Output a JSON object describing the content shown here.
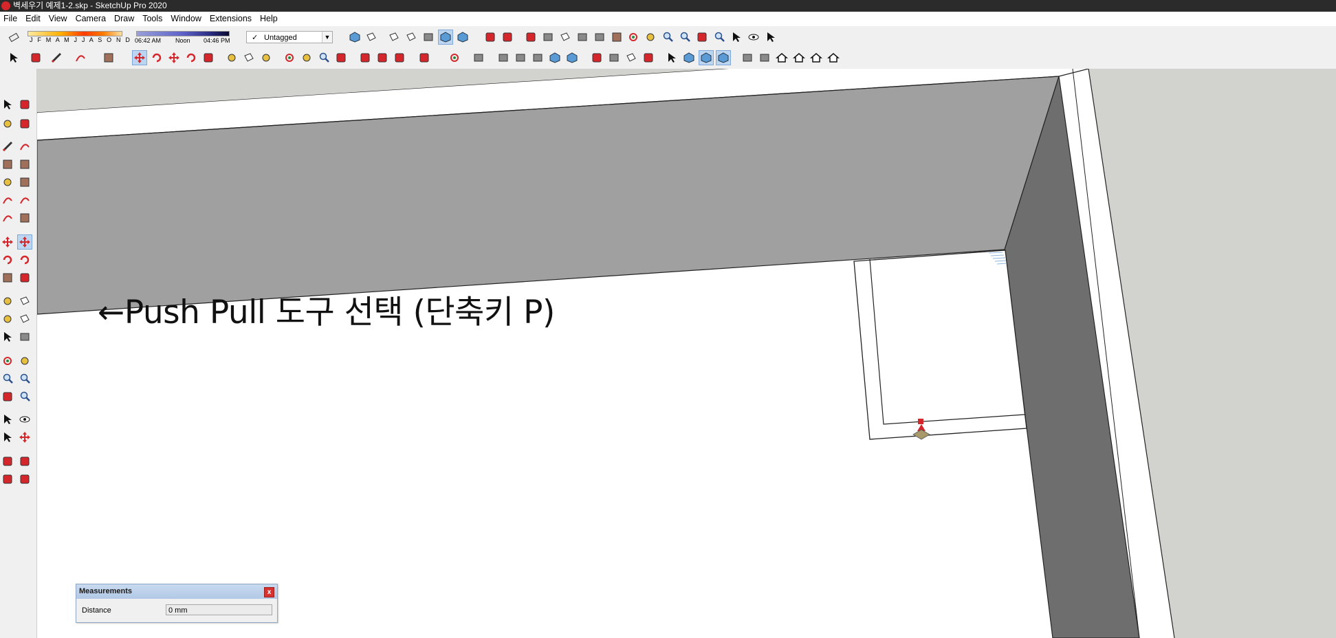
{
  "window": {
    "title": "벽세우기 예제1-2.skp - SketchUp Pro 2020"
  },
  "menu": [
    "File",
    "Edit",
    "View",
    "Camera",
    "Draw",
    "Tools",
    "Window",
    "Extensions",
    "Help"
  ],
  "shadows": {
    "months": "J F M A M J J A S O N D",
    "time_start": "06:42 AM",
    "time_noon": "Noon",
    "time_end": "04:46 PM"
  },
  "tags": {
    "selected": "Untagged",
    "check": "✓"
  },
  "annotation": {
    "text": "←Push Pull 도구 선택 (단축키 P)"
  },
  "measurements": {
    "title": "Measurements",
    "close": "x",
    "label": "Distance",
    "value": "0 mm"
  },
  "colors": {
    "titlebar": "#2b2b2b",
    "wall_top": "#a0a0a0",
    "wall_side": "#6e6e6e",
    "ground": "#d2d2cf",
    "accent_red": "#d4262b"
  }
}
